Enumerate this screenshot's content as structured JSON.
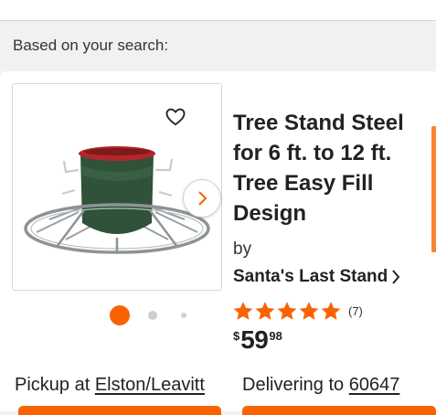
{
  "section": {
    "heading": "Based on your search:"
  },
  "product": {
    "title": "Tree Stand Steel for 6 ft. to 12 ft. Tree Easy Fill Design",
    "by_label": "by",
    "brand": "Santa's Last Stand",
    "rating": {
      "stars": 5,
      "max_stars": 5,
      "count_text": "(7)"
    },
    "price": {
      "currency": "$",
      "dollars": "59",
      "cents": "98"
    },
    "image": {
      "carousel_total": 3,
      "carousel_active": 1,
      "icons": {
        "favorite": "heart-outline-icon",
        "next": "chevron-right-icon"
      }
    }
  },
  "fulfillment": {
    "pickup_label": "Pickup at",
    "pickup_store": "Elston/Leavitt",
    "delivery_label": "Delivering to",
    "delivery_zip": "60647"
  },
  "colors": {
    "accent": "#f96302",
    "star": "#f96302",
    "text": "#222222",
    "background": "#f1f1f1"
  }
}
